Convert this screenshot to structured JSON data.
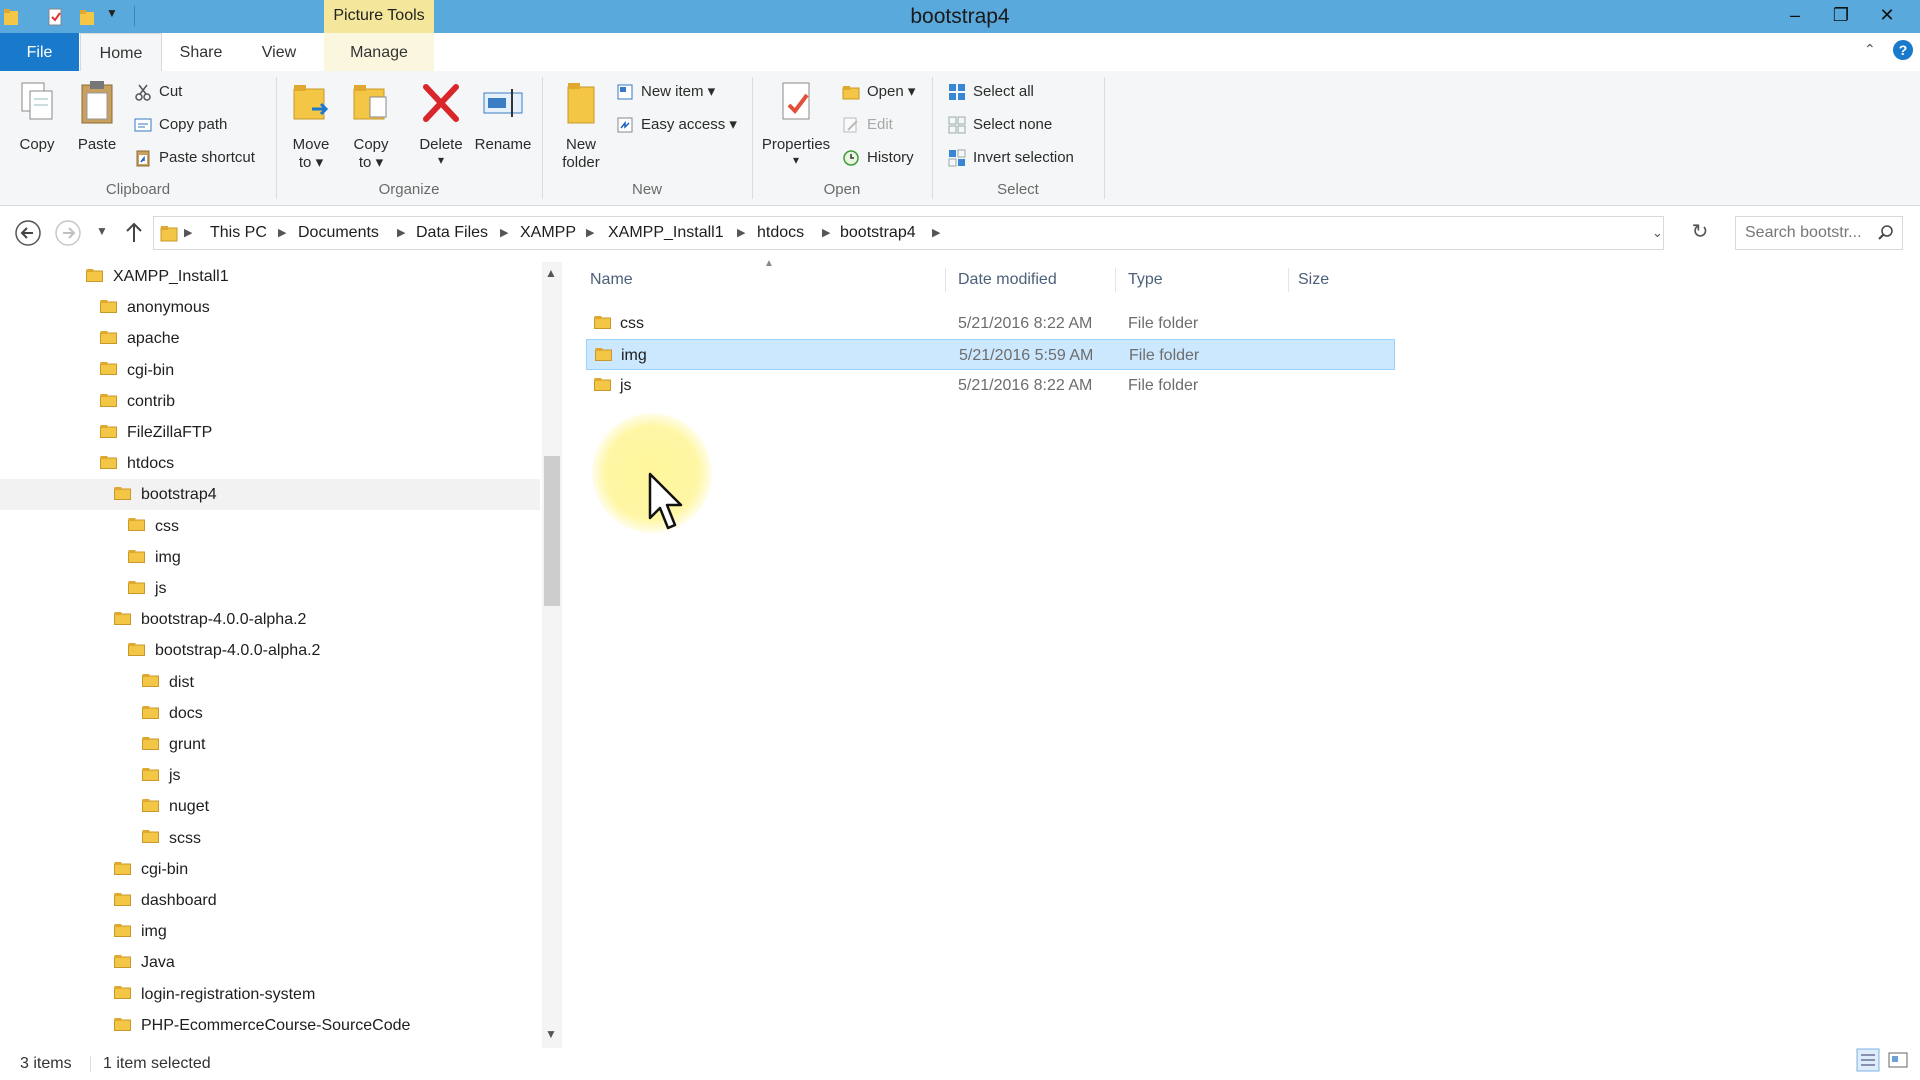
{
  "window": {
    "title": "bootstrap4",
    "context_tab": "Picture Tools",
    "minimize": "–",
    "restore": "❐",
    "close": "✕"
  },
  "tabs": {
    "file": "File",
    "home": "Home",
    "share": "Share",
    "view": "View",
    "manage": "Manage"
  },
  "ribbon": {
    "clipboard": {
      "group": "Clipboard",
      "copy": "Copy",
      "paste": "Paste",
      "cut": "Cut",
      "copy_path": "Copy path",
      "paste_shortcut": "Paste shortcut"
    },
    "organize": {
      "group": "Organize",
      "move_to_1": "Move",
      "move_to_2": "to ▾",
      "copy_to_1": "Copy",
      "copy_to_2": "to ▾",
      "delete": "Delete",
      "delete_arrow": "▾",
      "rename": "Rename"
    },
    "new": {
      "group": "New",
      "new_folder_1": "New",
      "new_folder_2": "folder",
      "new_item": "New item ▾",
      "easy_access": "Easy access ▾"
    },
    "open": {
      "group": "Open",
      "properties": "Properties",
      "properties_arrow": "▾",
      "open": "Open ▾",
      "edit": "Edit",
      "history": "History"
    },
    "select": {
      "group": "Select",
      "select_all": "Select all",
      "select_none": "Select none",
      "invert_selection": "Invert selection"
    }
  },
  "address": {
    "crumbs": [
      "This PC",
      "Documents",
      "Data Files",
      "XAMPP",
      "XAMPP_Install1",
      "htdocs",
      "bootstrap4"
    ],
    "search_placeholder": "Search bootstr..."
  },
  "tree": [
    {
      "label": "XAMPP_Install1",
      "level": 0,
      "selected": false
    },
    {
      "label": "anonymous",
      "level": 1,
      "selected": false
    },
    {
      "label": "apache",
      "level": 1,
      "selected": false
    },
    {
      "label": "cgi-bin",
      "level": 1,
      "selected": false
    },
    {
      "label": "contrib",
      "level": 1,
      "selected": false
    },
    {
      "label": "FileZillaFTP",
      "level": 1,
      "selected": false
    },
    {
      "label": "htdocs",
      "level": 1,
      "selected": false
    },
    {
      "label": "bootstrap4",
      "level": 2,
      "selected": true
    },
    {
      "label": "css",
      "level": 3,
      "selected": false
    },
    {
      "label": "img",
      "level": 3,
      "selected": false
    },
    {
      "label": "js",
      "level": 3,
      "selected": false
    },
    {
      "label": "bootstrap-4.0.0-alpha.2",
      "level": 2,
      "selected": false
    },
    {
      "label": "bootstrap-4.0.0-alpha.2",
      "level": 3,
      "selected": false
    },
    {
      "label": "dist",
      "level": 4,
      "selected": false
    },
    {
      "label": "docs",
      "level": 4,
      "selected": false
    },
    {
      "label": "grunt",
      "level": 4,
      "selected": false
    },
    {
      "label": "js",
      "level": 4,
      "selected": false
    },
    {
      "label": "nuget",
      "level": 4,
      "selected": false
    },
    {
      "label": "scss",
      "level": 4,
      "selected": false
    },
    {
      "label": "cgi-bin",
      "level": 2,
      "selected": false
    },
    {
      "label": "dashboard",
      "level": 2,
      "selected": false
    },
    {
      "label": "img",
      "level": 2,
      "selected": false
    },
    {
      "label": "Java",
      "level": 2,
      "selected": false
    },
    {
      "label": "login-registration-system",
      "level": 2,
      "selected": false
    },
    {
      "label": "PHP-EcommerceCourse-SourceCode",
      "level": 2,
      "selected": false
    }
  ],
  "columns": {
    "name": "Name",
    "date": "Date modified",
    "type": "Type",
    "size": "Size"
  },
  "files": [
    {
      "name": "css",
      "date": "5/21/2016 8:22 AM",
      "type": "File folder",
      "selected": false
    },
    {
      "name": "img",
      "date": "5/21/2016 5:59 AM",
      "type": "File folder",
      "selected": true
    },
    {
      "name": "js",
      "date": "5/21/2016 8:22 AM",
      "type": "File folder",
      "selected": false
    }
  ],
  "status": {
    "items": "3 items",
    "selected": "1 item selected"
  },
  "colors": {
    "titlebar": "#5aa9dc",
    "file_tab": "#1979ca",
    "context_tab": "#f4e69b",
    "selection": "#cce8ff",
    "folder": "#e8c25a"
  }
}
